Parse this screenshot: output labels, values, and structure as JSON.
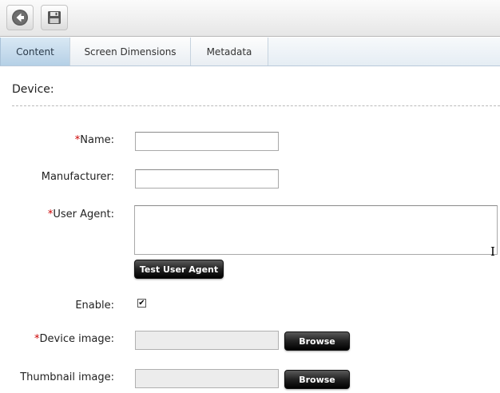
{
  "toolbar": {
    "back_icon": "back-arrow-icon",
    "save_icon": "floppy-disk-icon"
  },
  "tabs": [
    {
      "label": "Content",
      "active": true
    },
    {
      "label": "Screen Dimensions",
      "active": false
    },
    {
      "label": "Metadata",
      "active": false
    }
  ],
  "form": {
    "section_title": "Device:",
    "required_marker": "*",
    "name_label": "Name:",
    "name_value": "",
    "manufacturer_label": "Manufacturer:",
    "manufacturer_value": "",
    "user_agent_label": "User Agent:",
    "user_agent_value": "",
    "test_user_agent_button": "Test User Agent",
    "enable_label": "Enable:",
    "enable_checked": true,
    "checkmark": "✔",
    "device_image_label": "Device image:",
    "device_image_value": "",
    "thumbnail_image_label": "Thumbnail image:",
    "thumbnail_image_value": "",
    "browse_button": "Browse"
  },
  "colors": {
    "required": "#cc0000",
    "active_tab": "#c6dcee",
    "button_dark": "#1a1a1a"
  }
}
